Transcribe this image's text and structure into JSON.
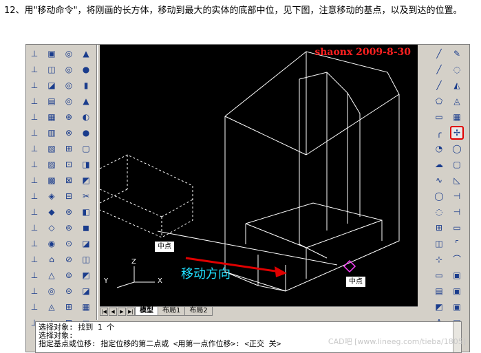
{
  "instruction": "12、用\"移动命令\"，将刚画的长方体，移动到最大的实体的底部中位，见下图，注意移动的基点，以及到达的位置。",
  "watermark": "shaonx 2009-8-30",
  "labels": {
    "midpoint_left": "中点",
    "midpoint_right": "中点",
    "move_direction": "移动方向"
  },
  "axis_labels": {
    "x": "X",
    "y": "Y",
    "z": "Z"
  },
  "tabs": {
    "model": "模型",
    "layout1": "布局1",
    "layout2": "布局2"
  },
  "nav_buttons": [
    "|◀",
    "◀",
    "▶",
    "▶|"
  ],
  "command_lines": [
    "选择对象: 找到 1 个",
    "选择对象:",
    "指定基点或位移: 指定位移的第二点或 <用第一点作位移>: <正交 关>"
  ],
  "footer_watermark": "CAD吧 [www.lineeg.com/tieba/1805]",
  "toolbar_left1": [
    "⊥",
    "⊥",
    "⊥",
    "⊥",
    "⊥",
    "⊥",
    "⊥",
    "⊥",
    "⊥",
    "⊥",
    "⊥",
    "⊥",
    "⊥",
    "⊥",
    "⊥",
    "⊥",
    "⊥",
    "⊥"
  ],
  "toolbar_left2": [
    "▣",
    "◫",
    "◪",
    "▤",
    "▦",
    "▥",
    "▧",
    "▨",
    "▩",
    "◈",
    "◆",
    "◇",
    "◉",
    "⌂",
    "△",
    "◎",
    "◬",
    "◭"
  ],
  "toolbar_left3": [
    "◎",
    "◎",
    "◎",
    "◎",
    "⊕",
    "⊗",
    "⊞",
    "⊡",
    "⊠",
    "⊟",
    "⊛",
    "⊚",
    "⊙",
    "⊘",
    "⊜",
    "⊝",
    "⊞",
    "⊟"
  ],
  "toolbar_left4": [
    "▲",
    "●",
    "▮",
    "▲",
    "◐",
    "●",
    "▢",
    "◨",
    "◩",
    "✂",
    "◧",
    "◼",
    "◪",
    "◫",
    "◩",
    "◪",
    "▦",
    "◻"
  ],
  "toolbar_right1": [
    "╱",
    "╱",
    "╱",
    "⬠",
    "▭",
    "╭",
    "◔",
    "☁",
    "∿",
    "◯",
    "◌",
    "⊞",
    "◫",
    "⊹",
    "▭",
    "▤",
    "◩",
    "A"
  ],
  "toolbar_right2": [
    "✎",
    "◌",
    "◭",
    "◬",
    "▦",
    "✢",
    "◯",
    "▢",
    "◺",
    "⊣",
    "⊣",
    "▭",
    "⌜",
    "⌒",
    "▣",
    "▣",
    "▣",
    "▣"
  ],
  "highlighted_tool": "move-icon",
  "colors": {
    "canvas_bg": "#000000",
    "wire": "#ffffff",
    "arrow": "#e00000",
    "watermark": "#ff2020",
    "move_text": "#20e0ff",
    "highlight": "#e00000"
  }
}
